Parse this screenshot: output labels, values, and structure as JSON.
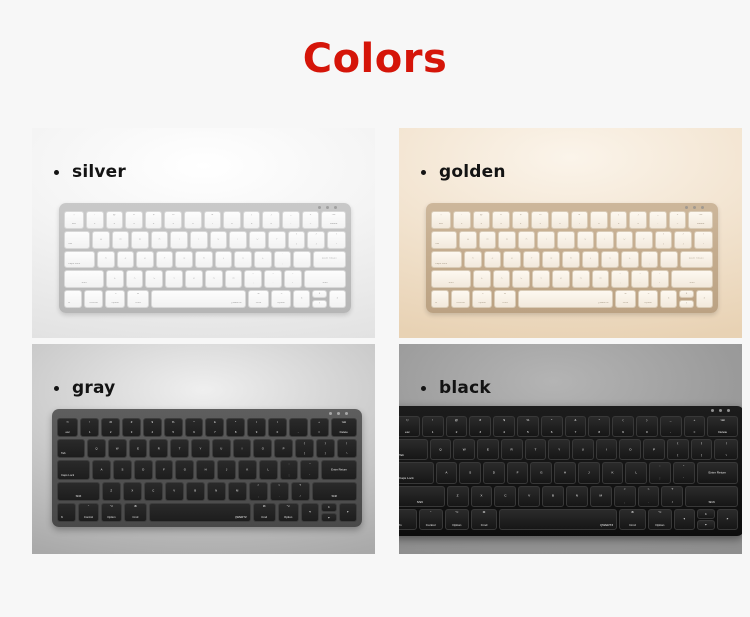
{
  "page": {
    "title": "Colors",
    "title_color": "#d51509",
    "background_color": "#f7f7f7"
  },
  "swatches": [
    {
      "id": "silver",
      "label": "silver",
      "bullet": "bullet-dot",
      "panel_background": "#f0f0f0",
      "body_color": "#bdbdbd",
      "key_color": "#f7f7f7",
      "legend_color": "#9a9a9a"
    },
    {
      "id": "golden",
      "label": "golden",
      "bullet": "bullet-dot",
      "panel_background": "#f3e5d2",
      "body_color": "#c3ab8d",
      "key_color": "#f6efe3",
      "legend_color": "#a79a87"
    },
    {
      "id": "gray",
      "label": "gray",
      "bullet": "bullet-dot",
      "panel_background": "#c6c6c6",
      "body_color": "#525252",
      "key_color": "#1d1d1d",
      "legend_color": "#e6e6e6"
    },
    {
      "id": "black",
      "label": "black",
      "bullet": "bullet-dot",
      "panel_background": "#9a9a9a",
      "body_color": "#141414",
      "key_color": "#1a1a1a",
      "legend_color": "#ededed"
    }
  ],
  "keyboard": {
    "indicator_count": 3,
    "spacebar_brand": "QWERTZ",
    "rows": [
      {
        "name": "number-row",
        "keys": [
          {
            "name": "escape",
            "top": "⎋",
            "bottom": "esc",
            "w": "w-esc"
          },
          {
            "name": "key-1",
            "top": "!",
            "bottom": "1"
          },
          {
            "name": "key-2",
            "top": "@",
            "bottom": "2"
          },
          {
            "name": "key-3",
            "top": "#",
            "bottom": "3"
          },
          {
            "name": "key-4",
            "top": "$",
            "bottom": "4"
          },
          {
            "name": "key-5",
            "top": "%",
            "bottom": "5"
          },
          {
            "name": "key-6",
            "top": "^",
            "bottom": "6"
          },
          {
            "name": "key-7",
            "top": "&",
            "bottom": "7"
          },
          {
            "name": "key-8",
            "top": "*",
            "bottom": "8"
          },
          {
            "name": "key-9",
            "top": "(",
            "bottom": "9"
          },
          {
            "name": "key-0",
            "top": ")",
            "bottom": "0"
          },
          {
            "name": "key-minus",
            "top": "_",
            "bottom": "-"
          },
          {
            "name": "key-equal",
            "top": "+",
            "bottom": "="
          },
          {
            "name": "delete",
            "top": "⌫",
            "bottom": "Delete",
            "w": "w-del"
          }
        ]
      },
      {
        "name": "qwerty-row",
        "keys": [
          {
            "name": "tab",
            "mid": "",
            "bl": "Tab",
            "w": "w-tab"
          },
          {
            "name": "key-q",
            "mid": "Q"
          },
          {
            "name": "key-w",
            "mid": "W"
          },
          {
            "name": "key-e",
            "mid": "E"
          },
          {
            "name": "key-r",
            "mid": "R"
          },
          {
            "name": "key-t",
            "mid": "T"
          },
          {
            "name": "key-y",
            "mid": "Y"
          },
          {
            "name": "key-u",
            "mid": "U"
          },
          {
            "name": "key-i",
            "mid": "I"
          },
          {
            "name": "key-o",
            "mid": "O"
          },
          {
            "name": "key-p",
            "mid": "P"
          },
          {
            "name": "key-bracket-left",
            "top": "{",
            "bottom": "["
          },
          {
            "name": "key-bracket-right",
            "top": "}",
            "bottom": "]"
          },
          {
            "name": "key-backslash",
            "top": "|",
            "bottom": "\\",
            "w": "w-bsl"
          }
        ]
      },
      {
        "name": "home-row",
        "keys": [
          {
            "name": "caps-lock",
            "bl": "Caps Lock",
            "w": "w-caps"
          },
          {
            "name": "key-a",
            "mid": "A"
          },
          {
            "name": "key-s",
            "mid": "S"
          },
          {
            "name": "key-d",
            "mid": "D"
          },
          {
            "name": "key-f",
            "mid": "F"
          },
          {
            "name": "key-g",
            "mid": "G"
          },
          {
            "name": "key-h",
            "mid": "H"
          },
          {
            "name": "key-j",
            "mid": "J"
          },
          {
            "name": "key-k",
            "mid": "K"
          },
          {
            "name": "key-l",
            "mid": "L"
          },
          {
            "name": "key-semicolon",
            "top": ":",
            "bottom": ";"
          },
          {
            "name": "key-quote",
            "top": "\"",
            "bottom": "'"
          },
          {
            "name": "enter-return",
            "mid": "Enter Return",
            "w": "w-ret"
          }
        ]
      },
      {
        "name": "shift-row",
        "keys": [
          {
            "name": "shift-left",
            "bottom": "Shift",
            "w": "w-shift"
          },
          {
            "name": "key-z",
            "mid": "Z"
          },
          {
            "name": "key-x",
            "mid": "X"
          },
          {
            "name": "key-c",
            "mid": "C"
          },
          {
            "name": "key-v",
            "mid": "V"
          },
          {
            "name": "key-b",
            "mid": "B"
          },
          {
            "name": "key-n",
            "mid": "N"
          },
          {
            "name": "key-m",
            "mid": "M"
          },
          {
            "name": "key-comma",
            "top": "<",
            "bottom": ","
          },
          {
            "name": "key-period",
            "top": ">",
            "bottom": "."
          },
          {
            "name": "key-slash",
            "top": "?",
            "bottom": "/"
          },
          {
            "name": "shift-right",
            "bottom": "Shift",
            "w": "w-shiftr"
          }
        ]
      },
      {
        "name": "modifier-row",
        "keys": [
          {
            "name": "fn",
            "bl": "fn",
            "w": "w-fn"
          },
          {
            "name": "control-left",
            "top": "⌃",
            "bottom": "Control",
            "w": "w-mod"
          },
          {
            "name": "option-left",
            "top": "⌥",
            "bottom": "Option",
            "w": "w-mod"
          },
          {
            "name": "command-left",
            "top": "⌘",
            "bottom": "Cmd",
            "w": "w-cmd"
          },
          {
            "name": "spacebar",
            "br": "QWERTZ",
            "w": "w-space"
          },
          {
            "name": "command-right",
            "top": "⌘",
            "bottom": "Cmd",
            "w": "w-cmd"
          },
          {
            "name": "option-right",
            "top": "⌥",
            "bottom": "Option",
            "w": "w-mod"
          },
          {
            "name": "arrow-left",
            "mid": "◂"
          },
          {
            "name": "arrow-up-down",
            "up": "▴",
            "down": "▾"
          },
          {
            "name": "arrow-right",
            "mid": "▸"
          }
        ]
      }
    ]
  }
}
